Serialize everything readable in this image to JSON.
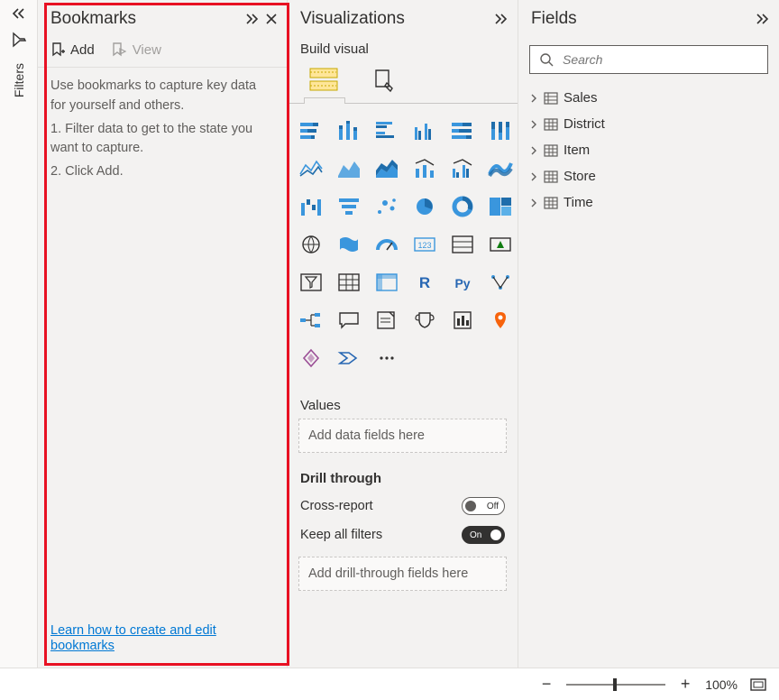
{
  "filters": {
    "label": "Filters"
  },
  "bookmarks": {
    "title": "Bookmarks",
    "add_label": "Add",
    "view_label": "View",
    "hint_intro": "Use bookmarks to capture key data for yourself and others.",
    "hint_step1": "1. Filter data to get to the state you want to capture.",
    "hint_step2": "2. Click Add.",
    "learn_link": "Learn how to create and edit bookmarks"
  },
  "visualizations": {
    "title": "Visualizations",
    "build_label": "Build visual",
    "values_label": "Values",
    "values_placeholder": "Add data fields here",
    "drill_label": "Drill through",
    "cross_report_label": "Cross-report",
    "cross_report_state": "Off",
    "keep_filters_label": "Keep all filters",
    "keep_filters_state": "On",
    "drill_placeholder": "Add drill-through fields here"
  },
  "fields": {
    "title": "Fields",
    "search_placeholder": "Search",
    "tables": [
      {
        "name": "Sales",
        "icon": "calc-table"
      },
      {
        "name": "District",
        "icon": "table"
      },
      {
        "name": "Item",
        "icon": "table"
      },
      {
        "name": "Store",
        "icon": "table"
      },
      {
        "name": "Time",
        "icon": "table"
      }
    ]
  },
  "zoom": {
    "level": "100%"
  }
}
